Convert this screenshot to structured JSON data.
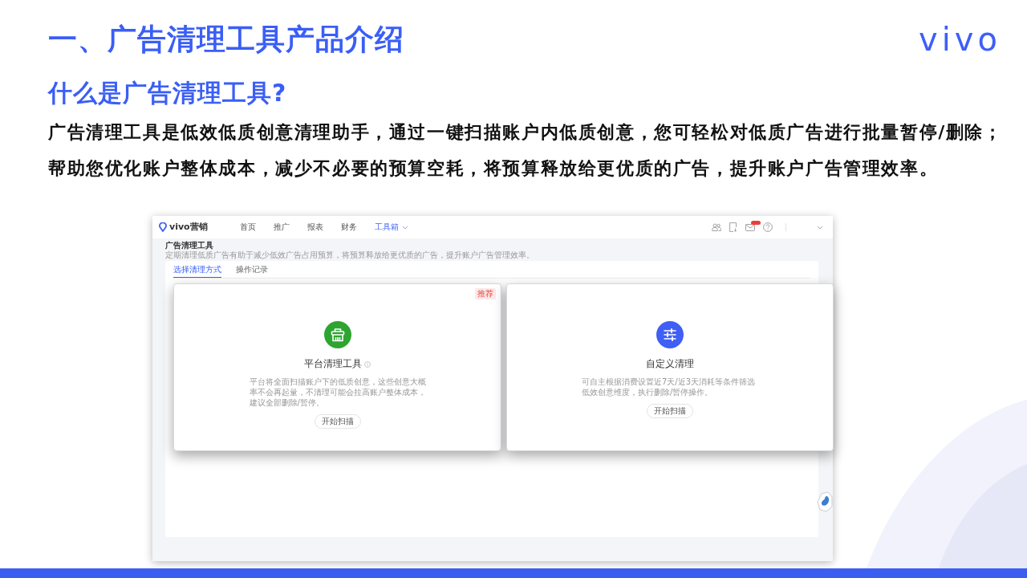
{
  "slide": {
    "title": "一、广告清理工具产品介绍",
    "logo": "vivo"
  },
  "section": {
    "heading": "什么是广告清理工具?",
    "paragraphs": [
      "广告清理工具是低效低质创意清理助手，通过一键扫描账户内低质创意，您可轻松对低质广告进行批量暂停/删除；",
      "帮助您优化账户整体成本，减少不必要的预算空耗，将预算释放给更优质的广告，提升账户广告管理效率。"
    ]
  },
  "screenshot": {
    "brand": "vivo营销",
    "nav": [
      {
        "label": "首页",
        "selected": false,
        "dropdown": false
      },
      {
        "label": "推广",
        "selected": false,
        "dropdown": false
      },
      {
        "label": "报表",
        "selected": false,
        "dropdown": false
      },
      {
        "label": "财务",
        "selected": false,
        "dropdown": false
      },
      {
        "label": "工具箱",
        "selected": true,
        "dropdown": true
      }
    ],
    "page_title": "广告清理工具",
    "page_description": "定期清理低质广告有助于减少低效广告占用预算，将预算释放给更优质的广告，提升账户广告管理效率。",
    "tabs": [
      {
        "label": "选择清理方式",
        "selected": true
      },
      {
        "label": "操作记录",
        "selected": false
      }
    ],
    "cards": [
      {
        "kind": "platform",
        "title": "平台清理工具",
        "info": true,
        "badge": "推荐",
        "description": "平台将全面扫描账户下的低质创意，这些创意大概率不会再起量，不清理可能会拉高账户整体成本，建议全部删除/暂停。",
        "button": "开始扫描"
      },
      {
        "kind": "custom",
        "title": "自定义清理",
        "info": false,
        "description": "可自主根据消费设置近7天/近3天消耗等条件筛选低效创意维度，执行删除/暂停操作。",
        "button": "开始扫描"
      }
    ]
  }
}
